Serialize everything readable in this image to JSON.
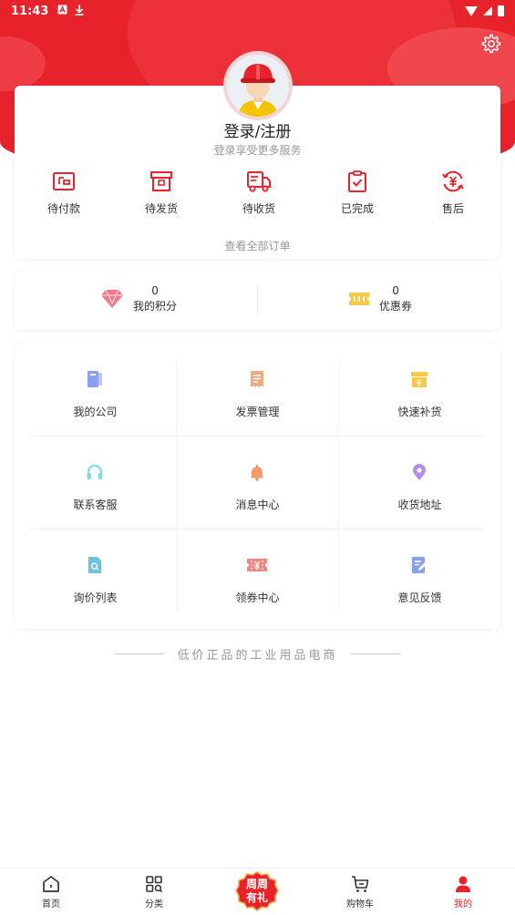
{
  "status_bar": {
    "time": "11:43",
    "icons": [
      "a-notification-icon",
      "download-icon",
      "wifi-icon",
      "signal-icon",
      "battery-icon"
    ]
  },
  "header": {
    "settings_icon": "gear-icon"
  },
  "user": {
    "login_title": "登录/注册",
    "login_subtitle": "登录享受更多服务"
  },
  "orders": {
    "items": [
      {
        "label": "待付款",
        "icon": "wallet-icon"
      },
      {
        "label": "待发货",
        "icon": "package-box-icon"
      },
      {
        "label": "待收货",
        "icon": "delivery-truck-icon"
      },
      {
        "label": "已完成",
        "icon": "clipboard-check-icon"
      },
      {
        "label": "售后",
        "icon": "refund-yen-icon"
      }
    ],
    "view_all": "查看全部订单"
  },
  "points": {
    "my_points": {
      "value": "0",
      "label": "我的积分",
      "icon": "diamond-icon"
    },
    "coupons": {
      "value": "0",
      "label": "优惠券",
      "icon": "ticket-icon"
    }
  },
  "services": [
    {
      "label": "我的公司",
      "icon": "company-book-icon",
      "color": "#8c9ef0"
    },
    {
      "label": "发票管理",
      "icon": "invoice-icon",
      "color": "#f2a982"
    },
    {
      "label": "快速补货",
      "icon": "restock-box-icon",
      "color": "#f7c948"
    },
    {
      "label": "联系客服",
      "icon": "headset-icon",
      "color": "#7fdde0"
    },
    {
      "label": "消息中心",
      "icon": "bell-icon",
      "color": "#f29a6c"
    },
    {
      "label": "收货地址",
      "icon": "location-pin-icon",
      "color": "#b48cec"
    },
    {
      "label": "询价列表",
      "icon": "search-document-icon",
      "color": "#6cc2e2"
    },
    {
      "label": "领券中心",
      "icon": "coupon-yen-icon",
      "color": "#f28585"
    },
    {
      "label": "意见反馈",
      "icon": "feedback-edit-icon",
      "color": "#8c9ef0"
    }
  ],
  "slogan": "低价正品的工业用品电商",
  "bottom_nav": {
    "items": [
      {
        "label": "首页",
        "icon": "home-icon",
        "active": false
      },
      {
        "label": "分类",
        "icon": "category-grid-icon",
        "active": false
      },
      {
        "label": "购物车",
        "icon": "cart-icon",
        "active": false
      },
      {
        "label": "我的",
        "icon": "user-icon",
        "active": true
      }
    ],
    "promo": {
      "line1": "周周",
      "line2": "有礼"
    }
  },
  "colors": {
    "brand_red": "#e8222a",
    "text": "#333333",
    "muted": "#999999"
  }
}
